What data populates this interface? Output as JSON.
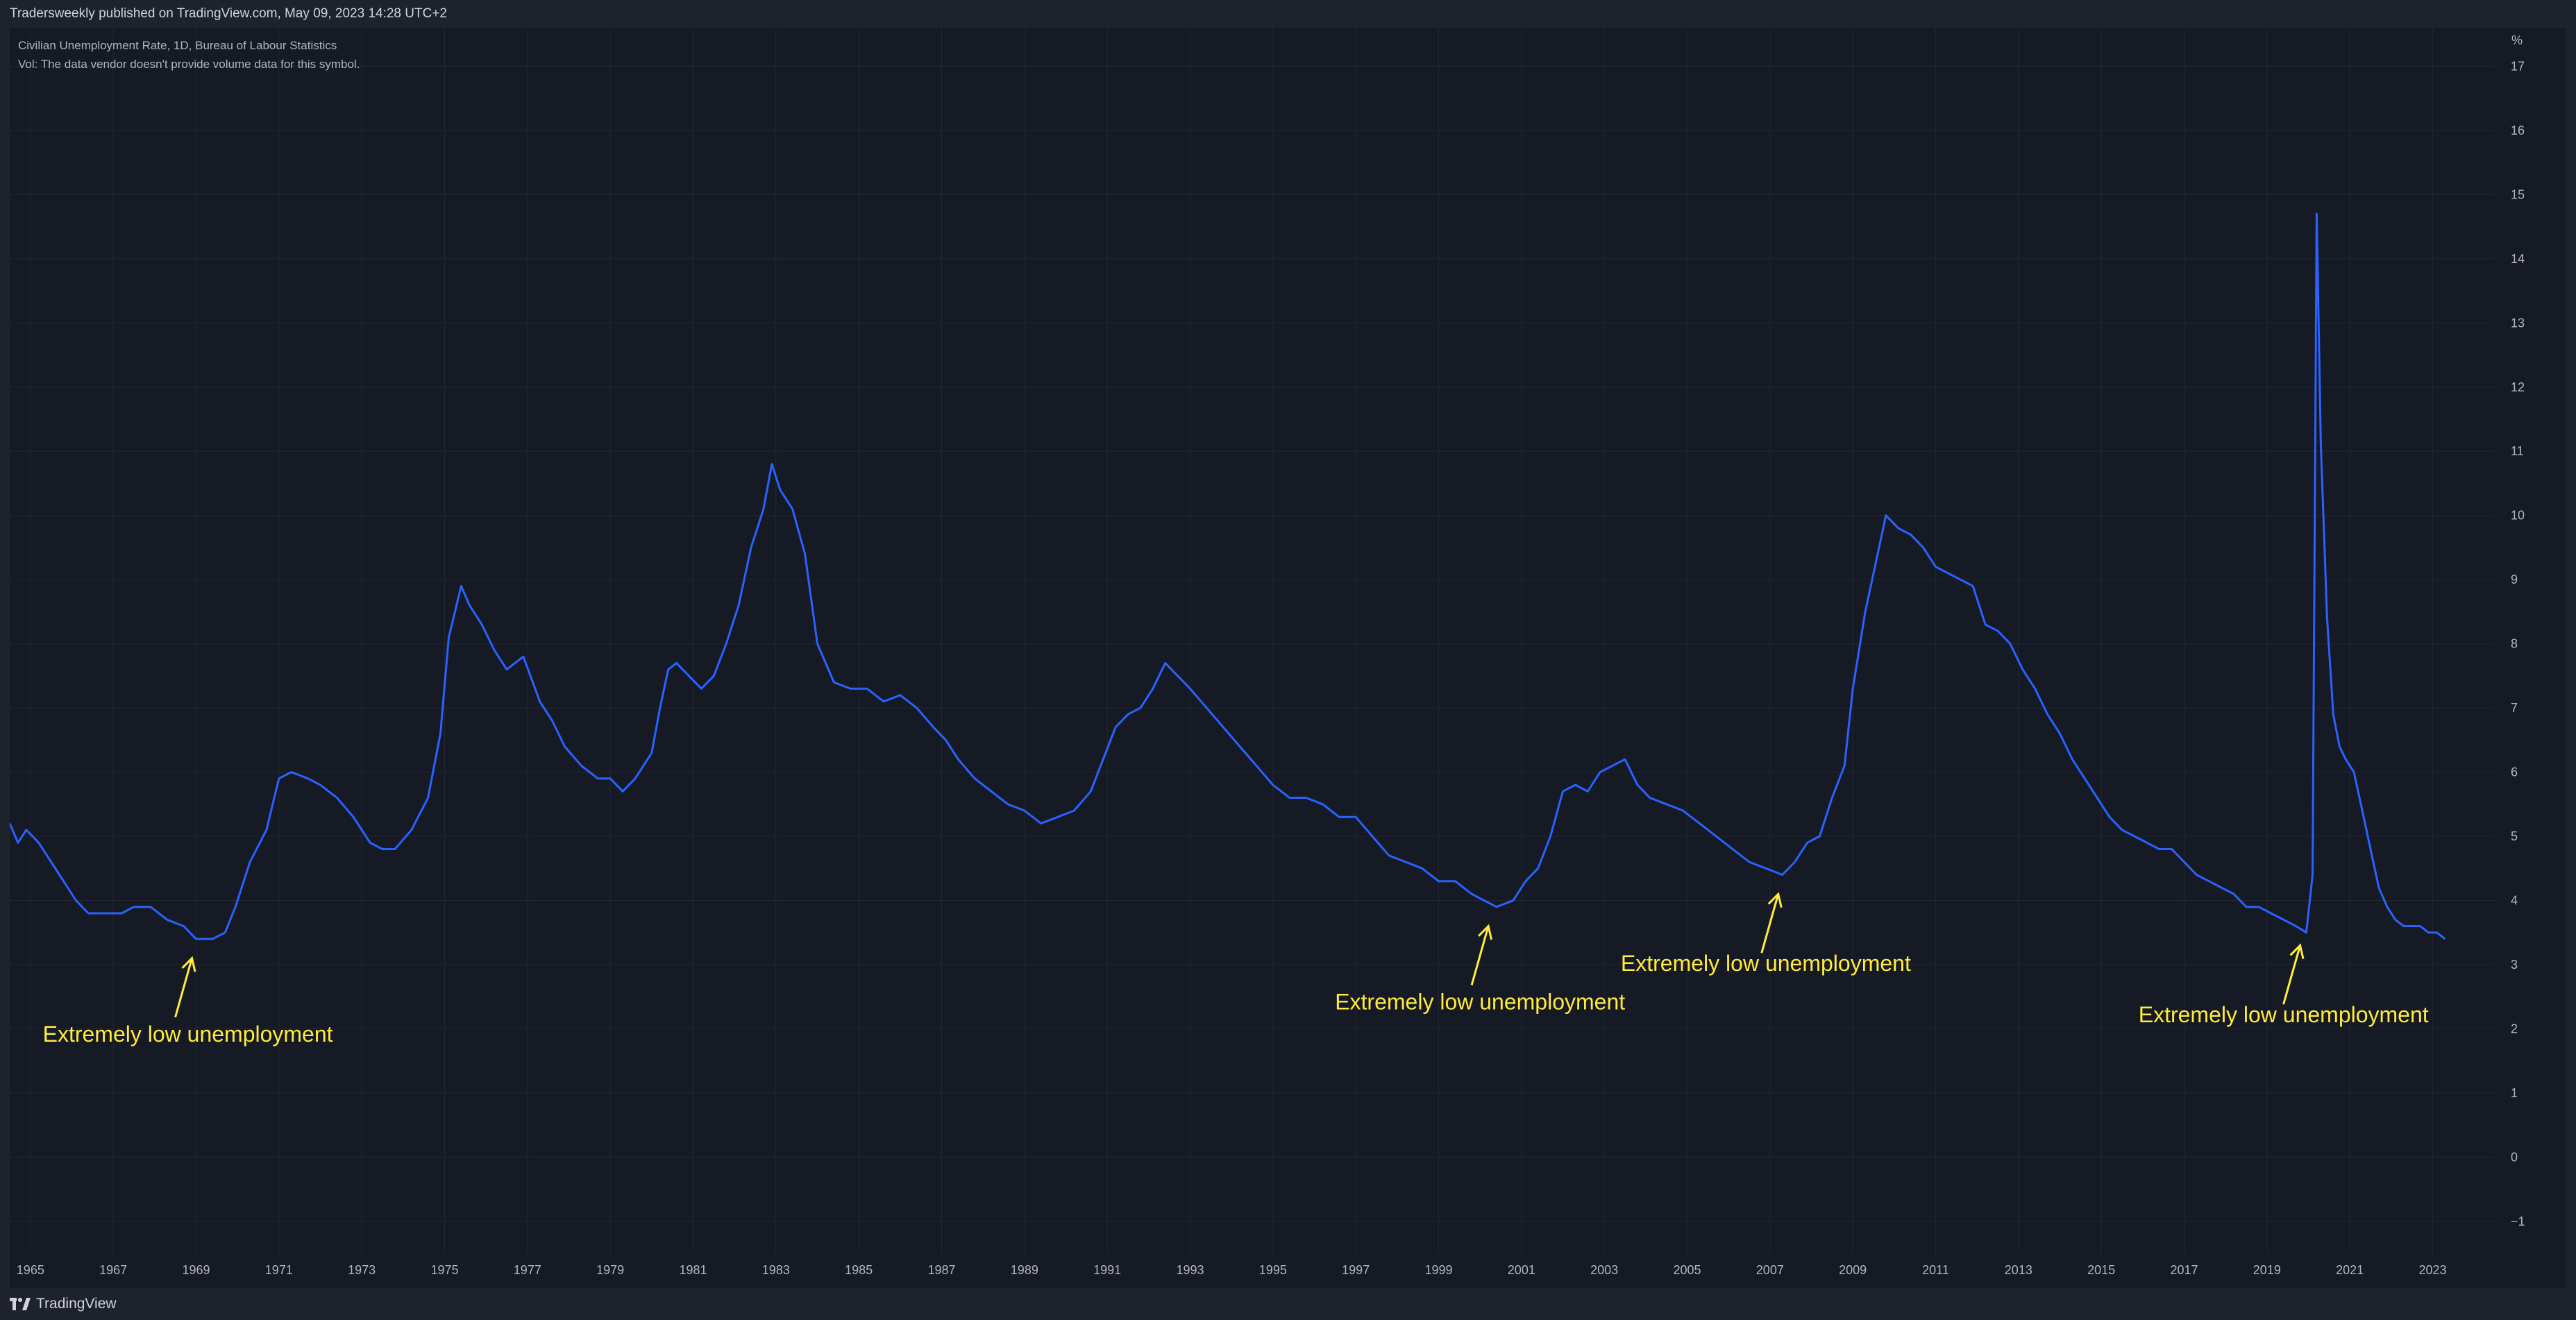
{
  "header": {
    "published_text": "Tradersweekly published on TradingView.com, May 09, 2023 14:28 UTC+2"
  },
  "legend": {
    "symbol_line": "Civilian Unemployment Rate, 1D, Bureau of Labour Statistics",
    "volume_line": "Vol: The data vendor doesn't provide volume data for this symbol."
  },
  "footer": {
    "brand": "TradingView"
  },
  "colors": {
    "background": "#161a25",
    "line": "#2962ff",
    "annotation": "#ffeb3b",
    "grid": "#232733"
  },
  "icons": {
    "logo": "tradingview-logo-icon"
  },
  "chart_data": {
    "type": "line",
    "ylabel": "%",
    "ylim": [
      -1.5,
      17.6
    ],
    "xlim": [
      1964.5,
      2024.5
    ],
    "y_ticks": [
      -1,
      0,
      1,
      2,
      3,
      4,
      5,
      6,
      7,
      8,
      9,
      10,
      11,
      12,
      13,
      14,
      15,
      16,
      17
    ],
    "y_tick_labels": [
      "−1",
      "0",
      "1",
      "2",
      "3",
      "4",
      "5",
      "6",
      "7",
      "8",
      "9",
      "10",
      "11",
      "12",
      "13",
      "14",
      "15",
      "16",
      "17"
    ],
    "x_ticks": [
      1965,
      1967,
      1969,
      1971,
      1973,
      1975,
      1977,
      1979,
      1981,
      1983,
      1985,
      1987,
      1989,
      1991,
      1993,
      1995,
      1997,
      1999,
      2001,
      2003,
      2005,
      2007,
      2009,
      2011,
      2013,
      2015,
      2017,
      2019,
      2021,
      2023
    ],
    "x_tick_labels": [
      "1965",
      "1967",
      "1969",
      "1971",
      "1973",
      "1975",
      "1977",
      "1979",
      "1981",
      "1983",
      "1985",
      "1987",
      "1989",
      "1991",
      "1993",
      "1995",
      "1997",
      "1999",
      "2001",
      "2003",
      "2005",
      "2007",
      "2009",
      "2011",
      "2013",
      "2015",
      "2017",
      "2019",
      "2021",
      "2023"
    ],
    "grid": true,
    "series": [
      {
        "name": "",
        "x": [
          1964.5,
          1964.7,
          1964.9,
          1965.2,
          1965.5,
          1965.8,
          1966.1,
          1966.4,
          1966.8,
          1967.2,
          1967.5,
          1967.9,
          1968.3,
          1968.7,
          1969.0,
          1969.4,
          1969.7,
          1969.95,
          1970.3,
          1970.7,
          1971.0,
          1971.3,
          1971.7,
          1972.0,
          1972.4,
          1972.8,
          1973.2,
          1973.5,
          1973.8,
          1974.2,
          1974.6,
          1974.9,
          1975.1,
          1975.4,
          1975.6,
          1975.9,
          1976.2,
          1976.5,
          1976.9,
          1977.3,
          1977.6,
          1977.9,
          1978.3,
          1978.7,
          1979.0,
          1979.3,
          1979.6,
          1980.0,
          1980.2,
          1980.4,
          1980.6,
          1980.9,
          1981.2,
          1981.5,
          1981.8,
          1982.1,
          1982.4,
          1982.7,
          1982.9,
          1983.1,
          1983.4,
          1983.7,
          1984.0,
          1984.4,
          1984.8,
          1985.2,
          1985.6,
          1986.0,
          1986.4,
          1986.8,
          1987.1,
          1987.4,
          1987.8,
          1988.2,
          1988.6,
          1989.0,
          1989.4,
          1989.8,
          1990.2,
          1990.6,
          1990.9,
          1991.2,
          1991.5,
          1991.8,
          1992.1,
          1992.4,
          1992.7,
          1993.0,
          1993.4,
          1993.8,
          1994.2,
          1994.6,
          1995.0,
          1995.4,
          1995.8,
          1996.2,
          1996.6,
          1997.0,
          1997.4,
          1997.8,
          1998.2,
          1998.6,
          1999.0,
          1999.4,
          1999.8,
          2000.1,
          2000.4,
          2000.8,
          2001.1,
          2001.4,
          2001.7,
          2002.0,
          2002.3,
          2002.6,
          2002.9,
          2003.2,
          2003.5,
          2003.8,
          2004.1,
          2004.5,
          2004.9,
          2005.3,
          2005.7,
          2006.1,
          2006.5,
          2006.9,
          2007.3,
          2007.6,
          2007.9,
          2008.2,
          2008.5,
          2008.8,
          2009.0,
          2009.3,
          2009.6,
          2009.8,
          2010.1,
          2010.4,
          2010.7,
          2011.0,
          2011.3,
          2011.6,
          2011.9,
          2012.2,
          2012.5,
          2012.8,
          2013.1,
          2013.4,
          2013.7,
          2014.0,
          2014.3,
          2014.6,
          2014.9,
          2015.2,
          2015.5,
          2015.8,
          2016.1,
          2016.4,
          2016.7,
          2017.0,
          2017.3,
          2017.6,
          2017.9,
          2018.2,
          2018.5,
          2018.8,
          2019.1,
          2019.4,
          2019.7,
          2019.95,
          2020.1,
          2020.2,
          2020.3,
          2020.45,
          2020.6,
          2020.75,
          2020.9,
          2021.1,
          2021.3,
          2021.5,
          2021.7,
          2021.9,
          2022.1,
          2022.3,
          2022.5,
          2022.7,
          2022.9,
          2023.1,
          2023.3
        ],
        "y": [
          5.2,
          4.9,
          5.1,
          4.9,
          4.6,
          4.3,
          4.0,
          3.8,
          3.8,
          3.8,
          3.9,
          3.9,
          3.7,
          3.6,
          3.4,
          3.4,
          3.5,
          3.9,
          4.6,
          5.1,
          5.9,
          6.0,
          5.9,
          5.8,
          5.6,
          5.3,
          4.9,
          4.8,
          4.8,
          5.1,
          5.6,
          6.6,
          8.1,
          8.9,
          8.6,
          8.3,
          7.9,
          7.6,
          7.8,
          7.1,
          6.8,
          6.4,
          6.1,
          5.9,
          5.9,
          5.7,
          5.9,
          6.3,
          7.0,
          7.6,
          7.7,
          7.5,
          7.3,
          7.5,
          8.0,
          8.6,
          9.5,
          10.1,
          10.8,
          10.4,
          10.1,
          9.4,
          8.0,
          7.4,
          7.3,
          7.3,
          7.1,
          7.2,
          7.0,
          6.7,
          6.5,
          6.2,
          5.9,
          5.7,
          5.5,
          5.4,
          5.2,
          5.3,
          5.4,
          5.7,
          6.2,
          6.7,
          6.9,
          7.0,
          7.3,
          7.7,
          7.5,
          7.3,
          7.0,
          6.7,
          6.4,
          6.1,
          5.8,
          5.6,
          5.6,
          5.5,
          5.3,
          5.3,
          5.0,
          4.7,
          4.6,
          4.5,
          4.3,
          4.3,
          4.1,
          4.0,
          3.9,
          4.0,
          4.3,
          4.5,
          5.0,
          5.7,
          5.8,
          5.7,
          6.0,
          6.1,
          6.2,
          5.8,
          5.6,
          5.5,
          5.4,
          5.2,
          5.0,
          4.8,
          4.6,
          4.5,
          4.4,
          4.6,
          4.9,
          5.0,
          5.6,
          6.1,
          7.3,
          8.5,
          9.4,
          10.0,
          9.8,
          9.7,
          9.5,
          9.2,
          9.1,
          9.0,
          8.9,
          8.3,
          8.2,
          8.0,
          7.6,
          7.3,
          6.9,
          6.6,
          6.2,
          5.9,
          5.6,
          5.3,
          5.1,
          5.0,
          4.9,
          4.8,
          4.8,
          4.6,
          4.4,
          4.3,
          4.2,
          4.1,
          3.9,
          3.9,
          3.8,
          3.7,
          3.6,
          3.5,
          4.4,
          14.7,
          11.1,
          8.4,
          6.9,
          6.4,
          6.2,
          6.0,
          5.4,
          4.8,
          4.2,
          3.9,
          3.7,
          3.6,
          3.6,
          3.6,
          3.5,
          3.5,
          3.4
        ]
      }
    ],
    "annotations": [
      {
        "text": "Extremely low unemployment",
        "point": [
          1968.9,
          3.1
        ],
        "label_at": [
          1968.8,
          1.8
        ]
      },
      {
        "text": "Extremely low unemployment",
        "point": [
          2000.2,
          3.6
        ],
        "label_at": [
          2000.0,
          2.3
        ]
      },
      {
        "text": "Extremely low unemployment",
        "point": [
          2007.2,
          4.1
        ],
        "label_at": [
          2006.9,
          2.9
        ]
      },
      {
        "text": "Extremely low unemployment",
        "point": [
          2019.8,
          3.3
        ],
        "label_at": [
          2019.4,
          2.1
        ]
      }
    ]
  }
}
